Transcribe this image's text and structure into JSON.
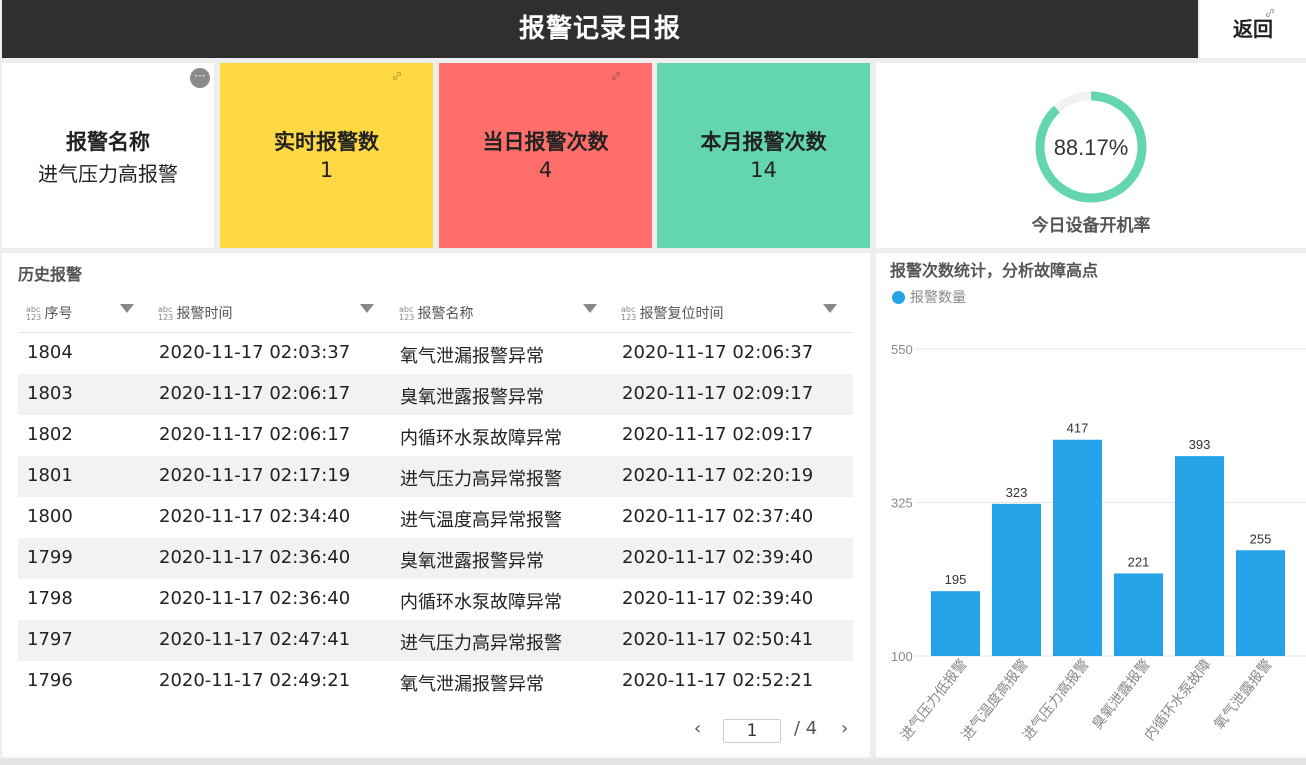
{
  "header": {
    "title": "报警记录日报",
    "back_label": "返回"
  },
  "cards": {
    "alarm_name": {
      "label": "报警名称",
      "value": "进气压力高报警"
    },
    "realtime": {
      "label": "实时报警数",
      "value": "1"
    },
    "daily": {
      "label": "当日报警次数",
      "value": "4"
    },
    "monthly": {
      "label": "本月报警次数",
      "value": "14"
    }
  },
  "gauge": {
    "value_text": "88.17%",
    "value": 88.17,
    "label": "今日设备开机率",
    "color": "#63d6b1"
  },
  "history": {
    "title": "历史报警",
    "type_icon": "abc/123",
    "columns": [
      "序号",
      "报警时间",
      "报警名称",
      "报警复位时间"
    ],
    "rows": [
      [
        "1804",
        "2020-11-17 02:03:37",
        "氧气泄漏报警异常",
        "2020-11-17 02:06:37"
      ],
      [
        "1803",
        "2020-11-17 02:06:17",
        "臭氧泄露报警异常",
        "2020-11-17 02:09:17"
      ],
      [
        "1802",
        "2020-11-17 02:06:17",
        "内循环水泵故障异常",
        "2020-11-17 02:09:17"
      ],
      [
        "1801",
        "2020-11-17 02:17:19",
        "进气压力高异常报警",
        "2020-11-17 02:20:19"
      ],
      [
        "1800",
        "2020-11-17 02:34:40",
        "进气温度高异常报警",
        "2020-11-17 02:37:40"
      ],
      [
        "1799",
        "2020-11-17 02:36:40",
        "臭氧泄露报警异常",
        "2020-11-17 02:39:40"
      ],
      [
        "1798",
        "2020-11-17 02:36:40",
        "内循环水泵故障异常",
        "2020-11-17 02:39:40"
      ],
      [
        "1797",
        "2020-11-17 02:47:41",
        "进气压力高异常报警",
        "2020-11-17 02:50:41"
      ],
      [
        "1796",
        "2020-11-17 02:49:21",
        "氧气泄漏报警异常",
        "2020-11-17 02:52:21"
      ]
    ],
    "pagination": {
      "prev": "‹",
      "current": "1",
      "total": "/ 4",
      "next": "›"
    }
  },
  "chart_title": "报警次数统计，分析故障高点",
  "chart_data": {
    "type": "bar",
    "categories": [
      "进气压力低报警",
      "进气温度高报警",
      "进气压力高报警",
      "臭氧泄露报警",
      "内循环水泵故障",
      "氧气泄露报警"
    ],
    "series": [
      {
        "name": "报警数量",
        "values": [
          195,
          323,
          417,
          221,
          393,
          255
        ]
      }
    ],
    "y_ticks": [
      "550",
      "325",
      "100"
    ],
    "ylim": [
      100,
      550
    ],
    "legend": "top-left",
    "grid": true,
    "color": "#26a2e8"
  },
  "colors": {
    "realtime": "#ffd944",
    "daily": "#ff6e6a",
    "monthly": "#63d6b1",
    "bar": "#26a2e8"
  }
}
